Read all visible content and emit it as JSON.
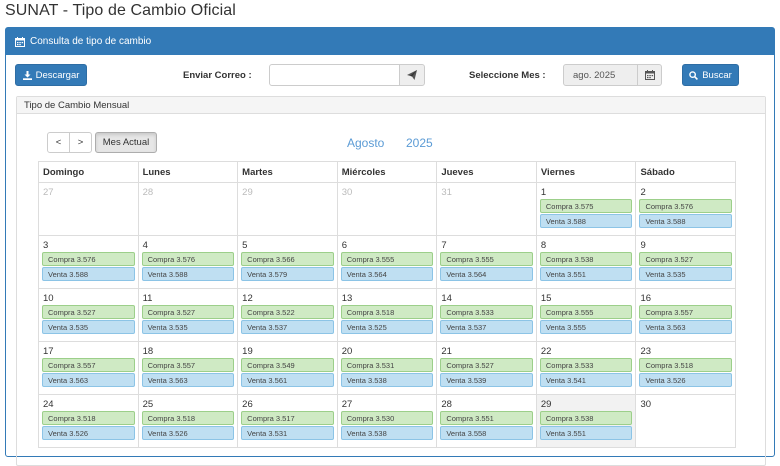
{
  "page": {
    "title": "SUNAT - Tipo de Cambio Oficial"
  },
  "panel": {
    "heading": "Consulta de tipo de cambio"
  },
  "toolbar": {
    "download_label": "Descargar",
    "email_label": "Enviar Correo :",
    "email_value": "",
    "month_label": "Seleccione Mes :",
    "month_value": "ago. 2025",
    "search_label": "Buscar"
  },
  "calendar": {
    "heading": "Tipo de Cambio Mensual",
    "prev": "<",
    "next": ">",
    "current_month_btn": "Mes Actual",
    "month_name": "Agosto",
    "year": "2025",
    "weekdays": [
      "Domingo",
      "Lunes",
      "Martes",
      "Miércoles",
      "Jueves",
      "Viernes",
      "Sábado"
    ],
    "weeks": [
      [
        {
          "day": "27",
          "other": true
        },
        {
          "day": "28",
          "other": true
        },
        {
          "day": "29",
          "other": true
        },
        {
          "day": "30",
          "other": true
        },
        {
          "day": "31",
          "other": true
        },
        {
          "day": "1",
          "buy": "Compra 3.575",
          "sell": "Venta 3.588"
        },
        {
          "day": "2",
          "buy": "Compra 3.576",
          "sell": "Venta 3.588"
        }
      ],
      [
        {
          "day": "3",
          "buy": "Compra 3.576",
          "sell": "Venta 3.588"
        },
        {
          "day": "4",
          "buy": "Compra 3.576",
          "sell": "Venta 3.588"
        },
        {
          "day": "5",
          "buy": "Compra 3.566",
          "sell": "Venta 3.579"
        },
        {
          "day": "6",
          "buy": "Compra 3.555",
          "sell": "Venta 3.564"
        },
        {
          "day": "7",
          "buy": "Compra 3.555",
          "sell": "Venta 3.564"
        },
        {
          "day": "8",
          "buy": "Compra 3.538",
          "sell": "Venta 3.551"
        },
        {
          "day": "9",
          "buy": "Compra 3.527",
          "sell": "Venta 3.535"
        }
      ],
      [
        {
          "day": "10",
          "buy": "Compra 3.527",
          "sell": "Venta 3.535"
        },
        {
          "day": "11",
          "buy": "Compra 3.527",
          "sell": "Venta 3.535"
        },
        {
          "day": "12",
          "buy": "Compra 3.522",
          "sell": "Venta 3.537"
        },
        {
          "day": "13",
          "buy": "Compra 3.518",
          "sell": "Venta 3.525"
        },
        {
          "day": "14",
          "buy": "Compra 3.533",
          "sell": "Venta 3.537"
        },
        {
          "day": "15",
          "buy": "Compra 3.555",
          "sell": "Venta 3.555"
        },
        {
          "day": "16",
          "buy": "Compra 3.557",
          "sell": "Venta 3.563"
        }
      ],
      [
        {
          "day": "17",
          "buy": "Compra 3.557",
          "sell": "Venta 3.563"
        },
        {
          "day": "18",
          "buy": "Compra 3.557",
          "sell": "Venta 3.563"
        },
        {
          "day": "19",
          "buy": "Compra 3.549",
          "sell": "Venta 3.561"
        },
        {
          "day": "20",
          "buy": "Compra 3.531",
          "sell": "Venta 3.538"
        },
        {
          "day": "21",
          "buy": "Compra 3.527",
          "sell": "Venta 3.539"
        },
        {
          "day": "22",
          "buy": "Compra 3.533",
          "sell": "Venta 3.541"
        },
        {
          "day": "23",
          "buy": "Compra 3.518",
          "sell": "Venta 3.526"
        }
      ],
      [
        {
          "day": "24",
          "buy": "Compra 3.518",
          "sell": "Venta 3.526"
        },
        {
          "day": "25",
          "buy": "Compra 3.518",
          "sell": "Venta 3.526"
        },
        {
          "day": "26",
          "buy": "Compra 3.517",
          "sell": "Venta 3.531"
        },
        {
          "day": "27",
          "buy": "Compra 3.530",
          "sell": "Venta 3.538"
        },
        {
          "day": "28",
          "buy": "Compra 3.551",
          "sell": "Venta 3.558"
        },
        {
          "day": "29",
          "buy": "Compra 3.538",
          "sell": "Venta 3.551",
          "today": true
        },
        {
          "day": "30"
        }
      ]
    ]
  },
  "colors": {
    "primary": "#337ab7",
    "buy_bg": "#cfeac4",
    "sell_bg": "#bfdff2",
    "month_title": "#5b9bd5"
  },
  "icons": {
    "heading": "calendar-icon",
    "download": "download-icon",
    "send": "send-icon",
    "month_picker": "calendar-icon",
    "search": "search-icon"
  }
}
